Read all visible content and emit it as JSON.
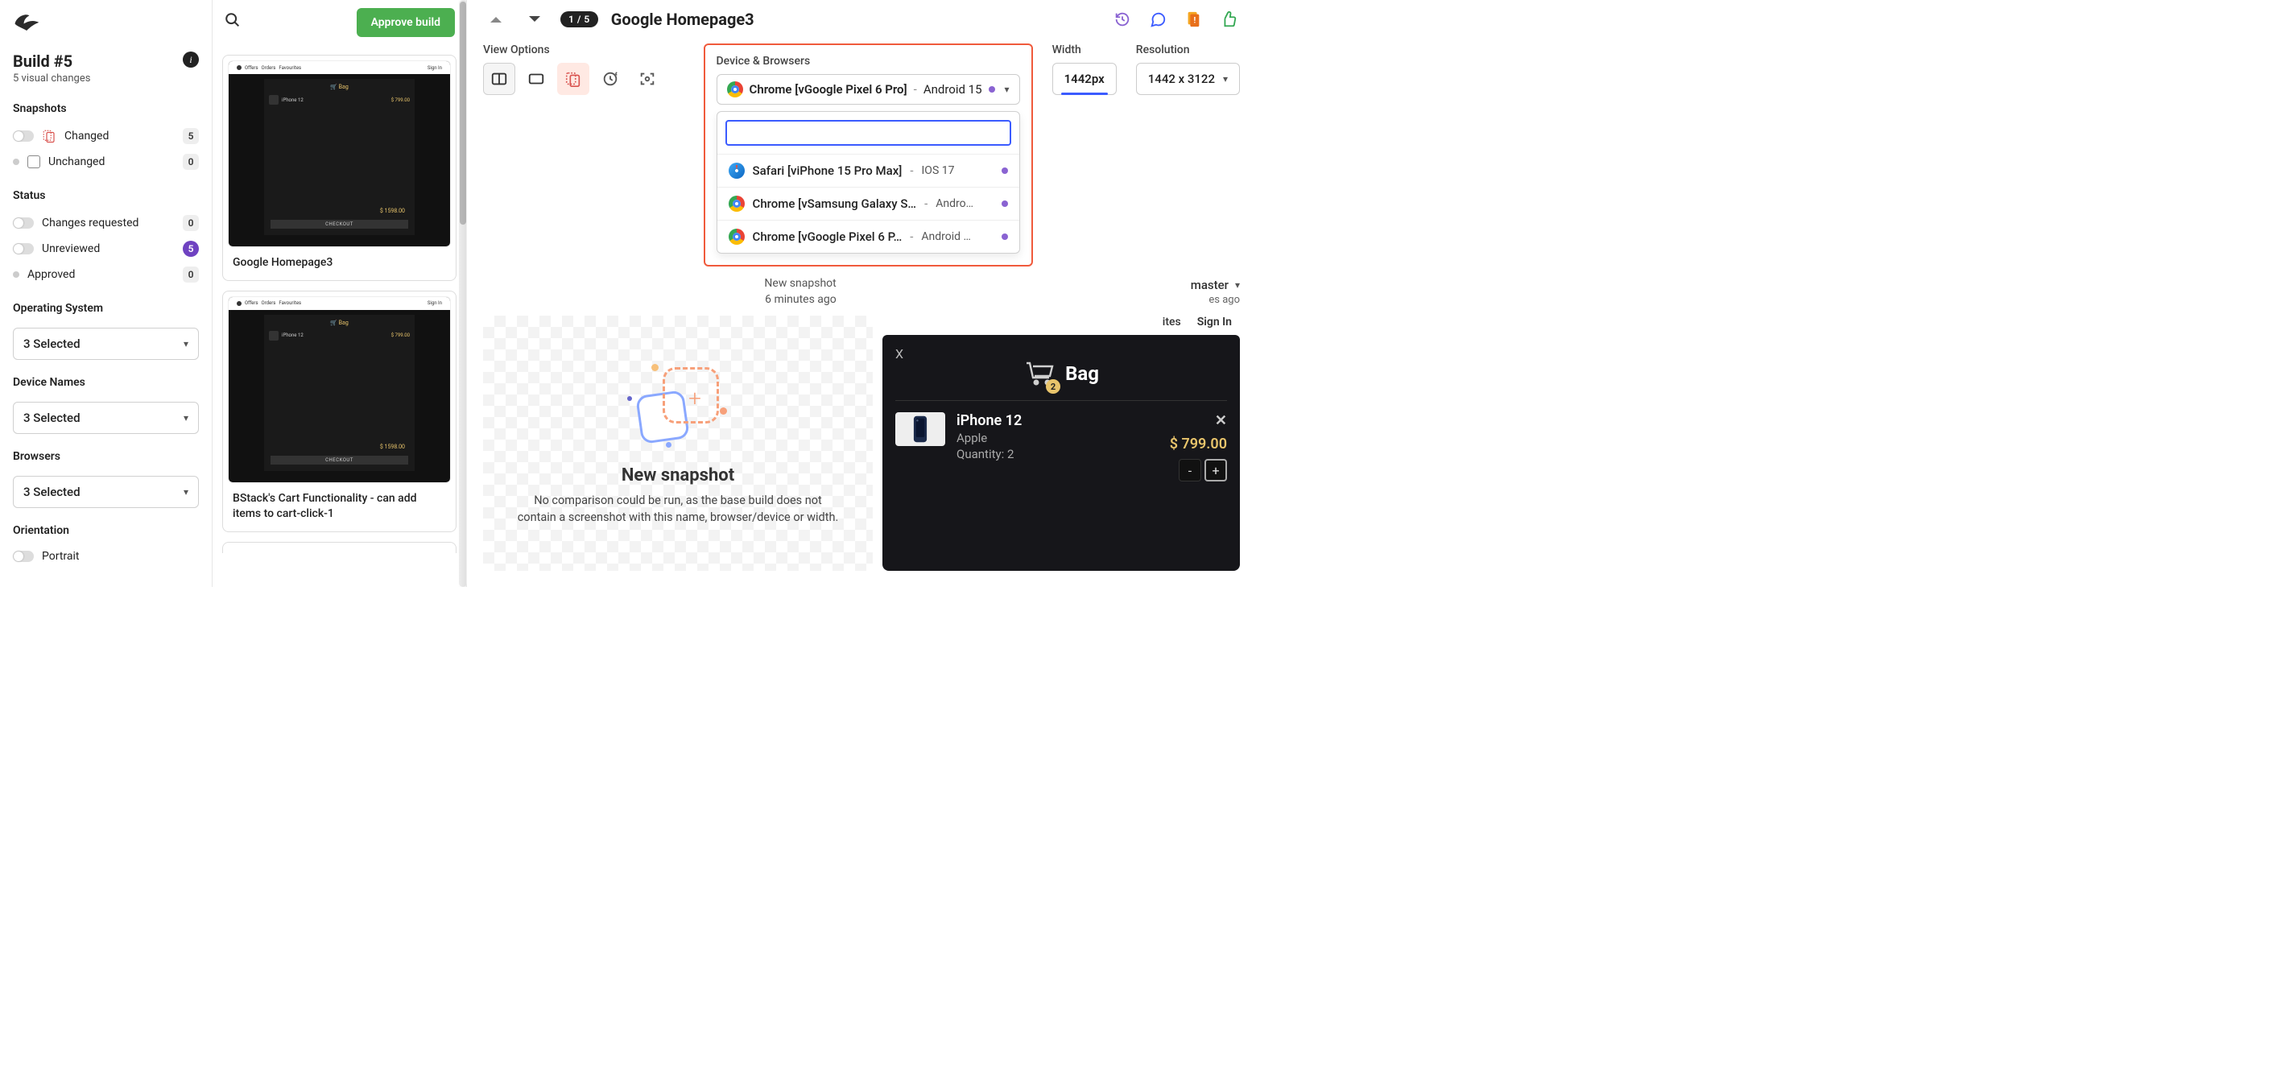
{
  "build": {
    "title": "Build #5",
    "sub": "5 visual changes"
  },
  "sidebar": {
    "snapshots_label": "Snapshots",
    "changed": {
      "label": "Changed",
      "count": "5"
    },
    "unchanged": {
      "label": "Unchanged",
      "count": "0"
    },
    "status_label": "Status",
    "changes_requested": {
      "label": "Changes requested",
      "count": "0"
    },
    "unreviewed": {
      "label": "Unreviewed",
      "count": "5"
    },
    "approved": {
      "label": "Approved",
      "count": "0"
    },
    "os_label": "Operating System",
    "os_value": "3 Selected",
    "devices_label": "Device Names",
    "devices_value": "3 Selected",
    "browsers_label": "Browsers",
    "browsers_value": "3 Selected",
    "orientation_label": "Orientation",
    "orientation_value": "Portrait"
  },
  "toolbar": {
    "approve": "Approve build"
  },
  "snapshots": [
    {
      "name": "Google Homepage3",
      "total": "$ 1598.00",
      "checkout": "CHECKOUT",
      "bag": "Bag",
      "product": "iPhone 12"
    },
    {
      "name": "BStack's Cart Functionality - can add items to cart-click-1",
      "total": "$ 1598.00",
      "checkout": "CHECKOUT",
      "bag": "Bag",
      "product": "iPhone 12"
    }
  ],
  "viewer": {
    "counter": "1 / 5",
    "title": "Google Homepage3",
    "view_options_label": "View Options",
    "device_browsers_label": "Device & Browsers",
    "width_label": "Width",
    "width_value": "1442px",
    "resolution_label": "Resolution",
    "resolution_value": "1442 x 3122",
    "new_snapshot_title": "New snapshot",
    "new_snapshot_time": "6 minutes ago",
    "branch": "master",
    "branch_time_suffix": "es ago",
    "empty_heading": "New snapshot",
    "empty_body": "No comparison could be run, as the base build does not contain a screenshot with this name, browser/device or width."
  },
  "device_selector": {
    "selected_name": "Chrome [vGoogle Pixel 6 Pro]",
    "selected_os": "Android 15",
    "options": [
      {
        "name": "Safari [viPhone 15 Pro Max]",
        "os": "IOS 17",
        "browser": "safari"
      },
      {
        "name": "Chrome [vSamsung Galaxy S…",
        "os": "Andro…",
        "browser": "chrome"
      },
      {
        "name": "Chrome [vGoogle Pixel 6 P…",
        "os": "Android …",
        "browser": "chrome"
      }
    ]
  },
  "right_header": {
    "favorites": "ites",
    "signin": "Sign In"
  },
  "bag": {
    "title": "Bag",
    "badge": "2",
    "item": {
      "name": "iPhone 12",
      "brand": "Apple",
      "qty_label": "Quantity: 2",
      "price": "$ 799.00"
    },
    "close": "X",
    "minus": "-",
    "plus": "+",
    "remove": "✕"
  }
}
